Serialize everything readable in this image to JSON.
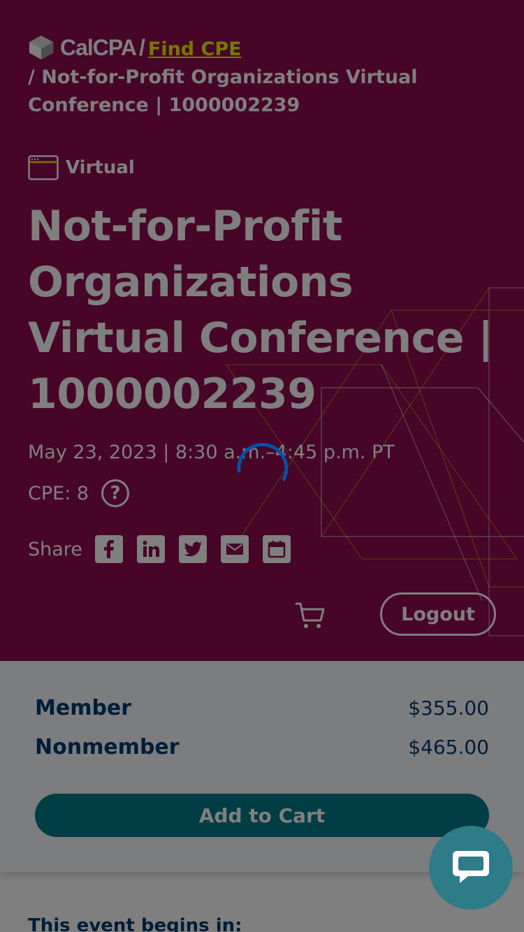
{
  "breadcrumb": {
    "logo_text": "CalCPA",
    "separator": "/",
    "find_cpe": "Find CPE",
    "current": "/ Not-for-Profit Organizations Virtual Conference | 1000002239"
  },
  "event": {
    "format": "Virtual",
    "title": "Not-for-Profit Organizations Virtual Conference | 1000002239",
    "datetime": "May 23, 2023 | 8:30 a.m.–4:45 p.m. PT",
    "cpe": "CPE: 8",
    "help_glyph": "?"
  },
  "share": {
    "label": "Share",
    "icons": [
      "facebook-icon",
      "linkedin-icon",
      "twitter-icon",
      "email-icon",
      "calendar-icon"
    ]
  },
  "header_actions": {
    "logout": "Logout"
  },
  "pricing": {
    "rows": [
      {
        "name": "Member",
        "price": "$355.00"
      },
      {
        "name": "Nonmember",
        "price": "$465.00"
      }
    ],
    "add_to_cart": "Add to Cart"
  },
  "countdown": {
    "label": "This event begins in:"
  },
  "colors": {
    "hero": "#8e0a4f",
    "link": "#e9f200",
    "primary_text": "#003a6e",
    "button": "#007b8a",
    "chat": "#2d7c88"
  }
}
